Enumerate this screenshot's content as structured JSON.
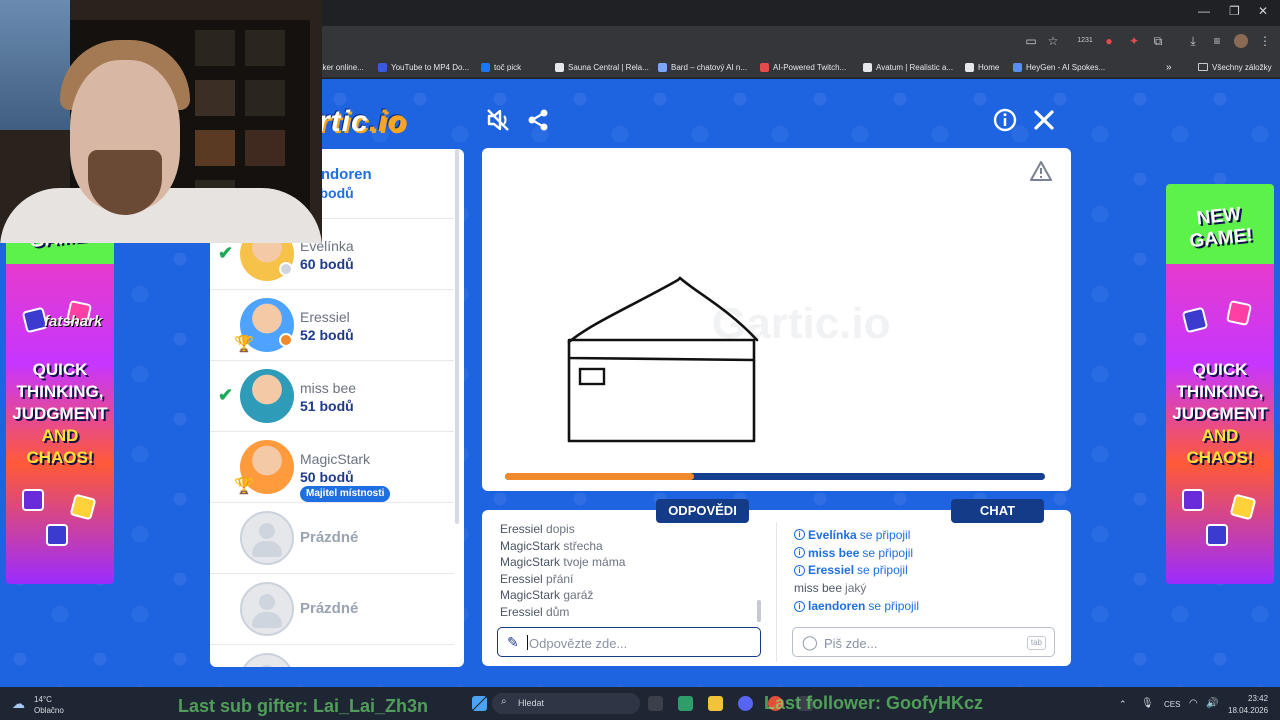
{
  "browser": {
    "bookmarks": [
      {
        "label": "aker online...",
        "color": "#9aa0a6"
      },
      {
        "label": "YouTube to MP4 Do...",
        "color": "#3a5bd9"
      },
      {
        "label": "toč pick",
        "color": "#1877f2"
      },
      {
        "label": "Sauna Central | Rela...",
        "color": "#e6e7ea"
      },
      {
        "label": "Bard – chatový AI n...",
        "color": "#7aa7f7"
      },
      {
        "label": "AI-Powered Twitch...",
        "color": "#e64a4a"
      },
      {
        "label": "Avatum | Realistic a...",
        "color": "#e6e7ea"
      },
      {
        "label": "Home",
        "color": "#e6e7ea"
      },
      {
        "label": "HeyGen - AI Spokes...",
        "color": "#5b8def"
      }
    ],
    "all_bookmarks_label": "Všechny záložky",
    "badge_count": "1231",
    "overflow": "»"
  },
  "game": {
    "logo_main": "rtic",
    "logo_dot": ".io",
    "players": [
      {
        "name": "laendoren",
        "score": "60 bodů",
        "checked": false,
        "trophy": false,
        "avatar_color": "#6fb6ff"
      },
      {
        "name": "Evelínka",
        "score": "60 bodů",
        "checked": true,
        "trophy": false,
        "avatar_color": "#f6c24a",
        "status_color": "#cfd5de"
      },
      {
        "name": "Eressiel",
        "score": "52 bodů",
        "checked": false,
        "trophy": true,
        "avatar_color": "#4da3ff",
        "status_color": "#f08a2c"
      },
      {
        "name": "miss bee",
        "score": "51 bodů",
        "checked": true,
        "trophy": false,
        "avatar_color": "#2e9cb8"
      },
      {
        "name": "MagicStark",
        "score": "50 bodů",
        "checked": false,
        "trophy": true,
        "avatar_color": "#ff9a3d",
        "owner_badge": "Majitel místnosti"
      }
    ],
    "empty_slot_label": "Prázdné",
    "progress": 0.35,
    "answers_tab": "ODPOVĚDI",
    "chat_tab": "CHAT",
    "answers": [
      {
        "who": "Eressiel",
        "text": "dopis"
      },
      {
        "who": "MagicStark",
        "text": "střecha"
      },
      {
        "who": "MagicStark",
        "text": "tvoje máma"
      },
      {
        "who": "Eressiel",
        "text": "přání"
      },
      {
        "who": "MagicStark",
        "text": "garáž"
      },
      {
        "who": "Eressiel",
        "text": "dům"
      }
    ],
    "chat": [
      {
        "who": "Evelínka",
        "text": "se připojil",
        "system": true
      },
      {
        "who": "miss bee",
        "text": "se připojil",
        "system": true
      },
      {
        "who": "Eressiel",
        "text": "se připojil",
        "system": true
      },
      {
        "who": "miss bee",
        "text": "jaký",
        "system": false
      },
      {
        "who": "laendoren",
        "text": "se připojil",
        "system": true
      }
    ],
    "answer_placeholder": "Odpovězte zde...",
    "chat_placeholder": "Piš zde...",
    "tab_key": "tab",
    "banner": {
      "new_game": "NEW GAME!",
      "line1": "QUICK",
      "line2": "THINKING,",
      "line3": "JUDGMENT",
      "line4": "AND",
      "line5": "CHAOS!"
    }
  },
  "stream": {
    "watermark": "fatshark",
    "sub_gifter": "Last sub gifter: Lai_Lai_Zh3n",
    "follower": "Last follower: GoofyHKcz"
  },
  "taskbar": {
    "temp": "14°C",
    "weather": "Oblačno",
    "search_placeholder": "Hledat",
    "lang": "CES",
    "time": "23:42",
    "date": "18.04.2026"
  }
}
